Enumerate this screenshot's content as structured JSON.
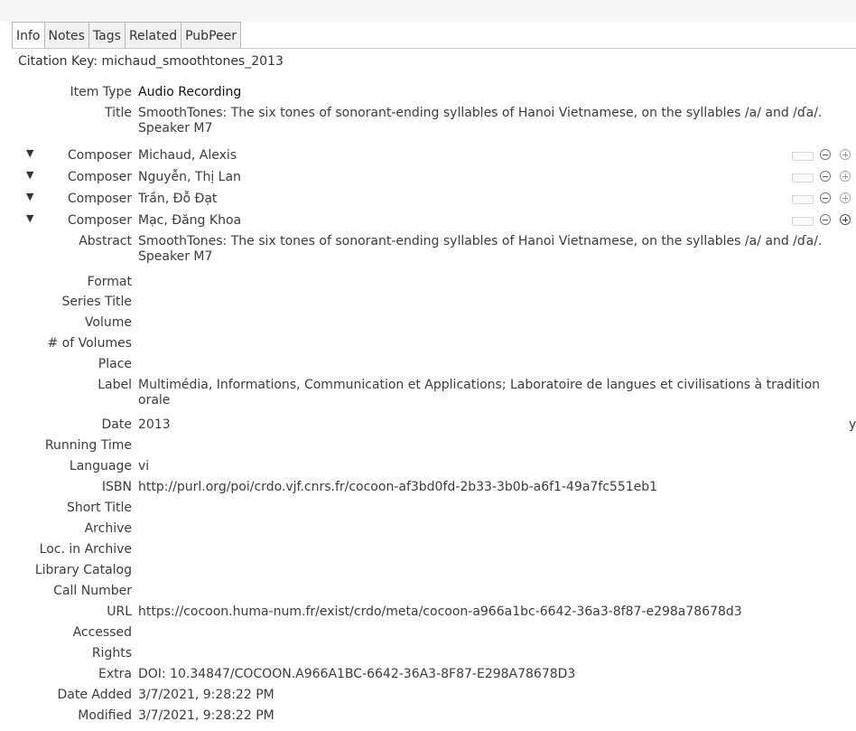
{
  "tabs": [
    "Info",
    "Notes",
    "Tags",
    "Related",
    "PubPeer"
  ],
  "citation_key": "Citation Key: michaud_smoothtones_2013",
  "fields": {
    "item_type": {
      "label": "Item Type",
      "value": "Audio Recording"
    },
    "title": {
      "label": "Title",
      "value": "SmoothTones: The six tones of sonorant-ending syllables of Hanoi Vietnamese, on the syllables /a/ and /ɗa/. Speaker M7"
    },
    "composers": [
      {
        "label": "Composer",
        "value": "Michaud, Alexis"
      },
      {
        "label": "Composer",
        "value": "Nguyễn, Thị Lan"
      },
      {
        "label": "Composer",
        "value": "Trần, Đỗ Đạt"
      },
      {
        "label": "Composer",
        "value": "Mạc, Đăng Khoa"
      }
    ],
    "abstract": {
      "label": "Abstract",
      "value": "SmoothTones: The six tones of sonorant-ending syllables of Hanoi Vietnamese, on the syllables /a/ and /ɗa/. Speaker M7"
    },
    "format": {
      "label": "Format",
      "value": ""
    },
    "series_title": {
      "label": "Series Title",
      "value": ""
    },
    "volume": {
      "label": "Volume",
      "value": ""
    },
    "num_volumes": {
      "label": "# of Volumes",
      "value": ""
    },
    "place": {
      "label": "Place",
      "value": ""
    },
    "label_field": {
      "label": "Label",
      "value": "Multimédia, Informations, Communication et Applications; Laboratoire de langues et civilisations à tradition orale"
    },
    "date": {
      "label": "Date",
      "value": "2013",
      "suffix": "y"
    },
    "running_time": {
      "label": "Running Time",
      "value": ""
    },
    "language": {
      "label": "Language",
      "value": "vi"
    },
    "isbn": {
      "label": "ISBN",
      "value": "http://purl.org/poi/crdo.vjf.cnrs.fr/cocoon-af3bd0fd-2b33-3b0b-a6f1-49a7fc551eb1"
    },
    "short_title": {
      "label": "Short Title",
      "value": ""
    },
    "archive": {
      "label": "Archive",
      "value": ""
    },
    "loc_in_archive": {
      "label": "Loc. in Archive",
      "value": ""
    },
    "library_catalog": {
      "label": "Library Catalog",
      "value": ""
    },
    "call_number": {
      "label": "Call Number",
      "value": ""
    },
    "url": {
      "label": "URL",
      "value": "https://cocoon.huma-num.fr/exist/crdo/meta/cocoon-a966a1bc-6642-36a3-8f87-e298a78678d3"
    },
    "accessed": {
      "label": "Accessed",
      "value": ""
    },
    "rights": {
      "label": "Rights",
      "value": ""
    },
    "extra": {
      "label": "Extra",
      "value": "DOI: 10.34847/COCOON.A966A1BC-6642-36A3-8F87-E298A78678D3"
    },
    "date_added": {
      "label": "Date Added",
      "value": "3/7/2021, 9:28:22 PM"
    },
    "modified": {
      "label": "Modified",
      "value": "3/7/2021, 9:28:22 PM"
    }
  }
}
